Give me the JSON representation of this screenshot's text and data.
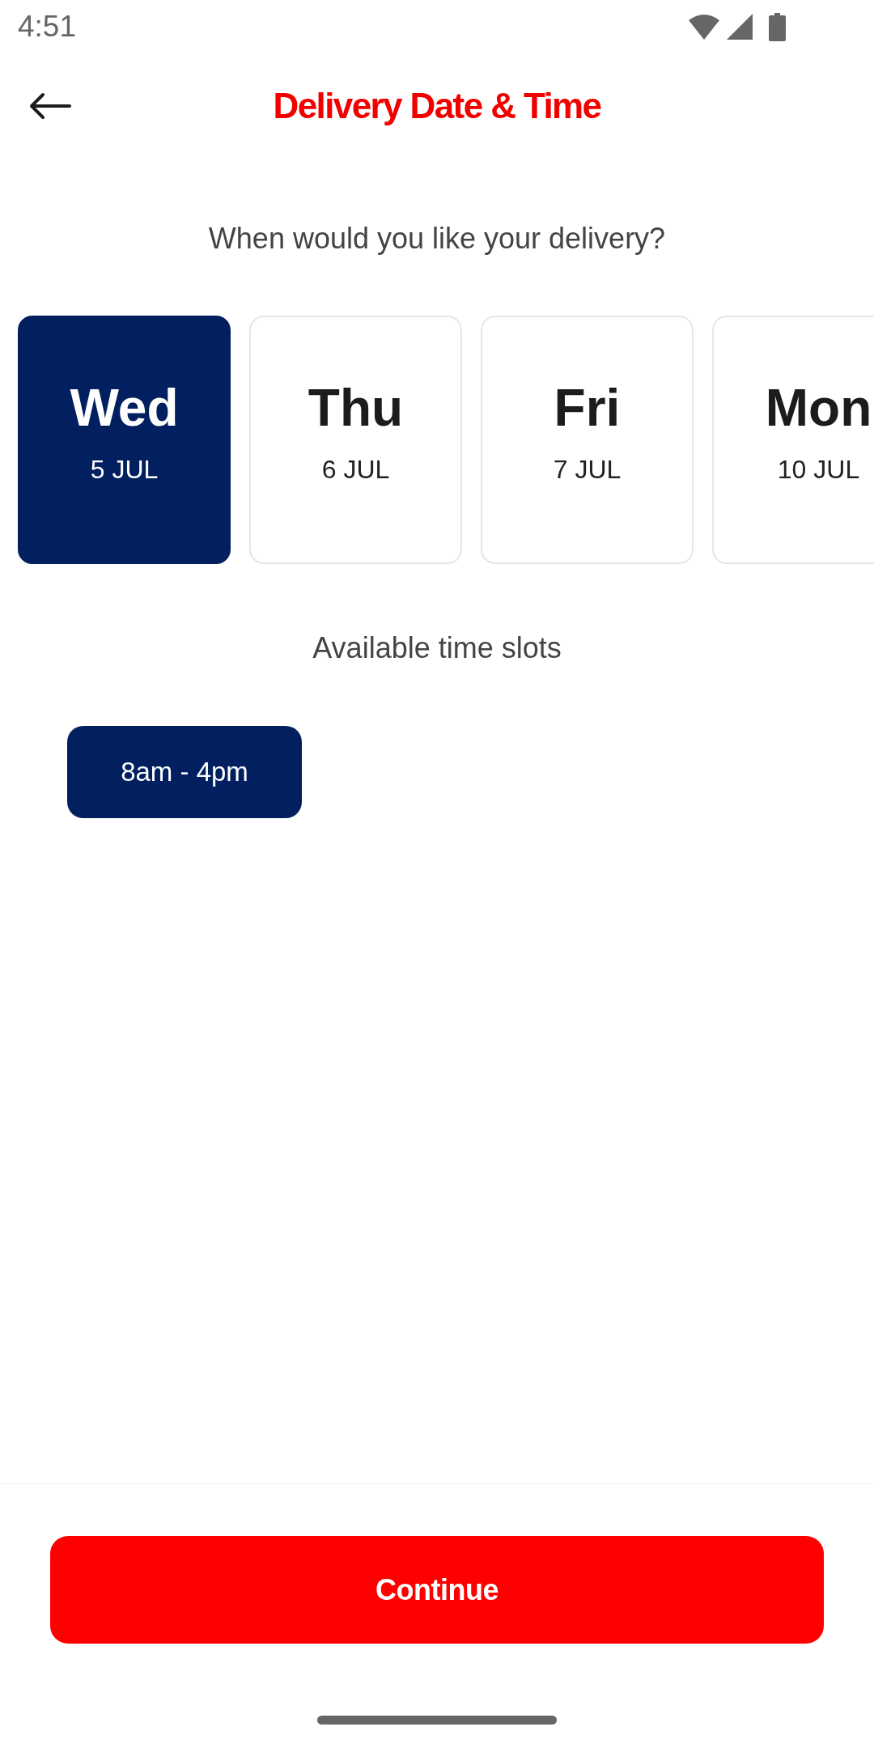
{
  "status_bar": {
    "time": "4:51"
  },
  "header": {
    "title": "Delivery Date & Time"
  },
  "date_prompt": "When would you like your delivery?",
  "days": [
    {
      "weekday": "Wed",
      "date": "5 JUL",
      "selected": true
    },
    {
      "weekday": "Thu",
      "date": "6 JUL",
      "selected": false
    },
    {
      "weekday": "Fri",
      "date": "7 JUL",
      "selected": false
    },
    {
      "weekday": "Mon",
      "date": "10 JUL",
      "selected": false
    }
  ],
  "time_slots_heading": "Available time slots",
  "time_slots": [
    {
      "label": "8am - 4pm",
      "selected": true
    }
  ],
  "primary_button": {
    "label": "Continue"
  }
}
